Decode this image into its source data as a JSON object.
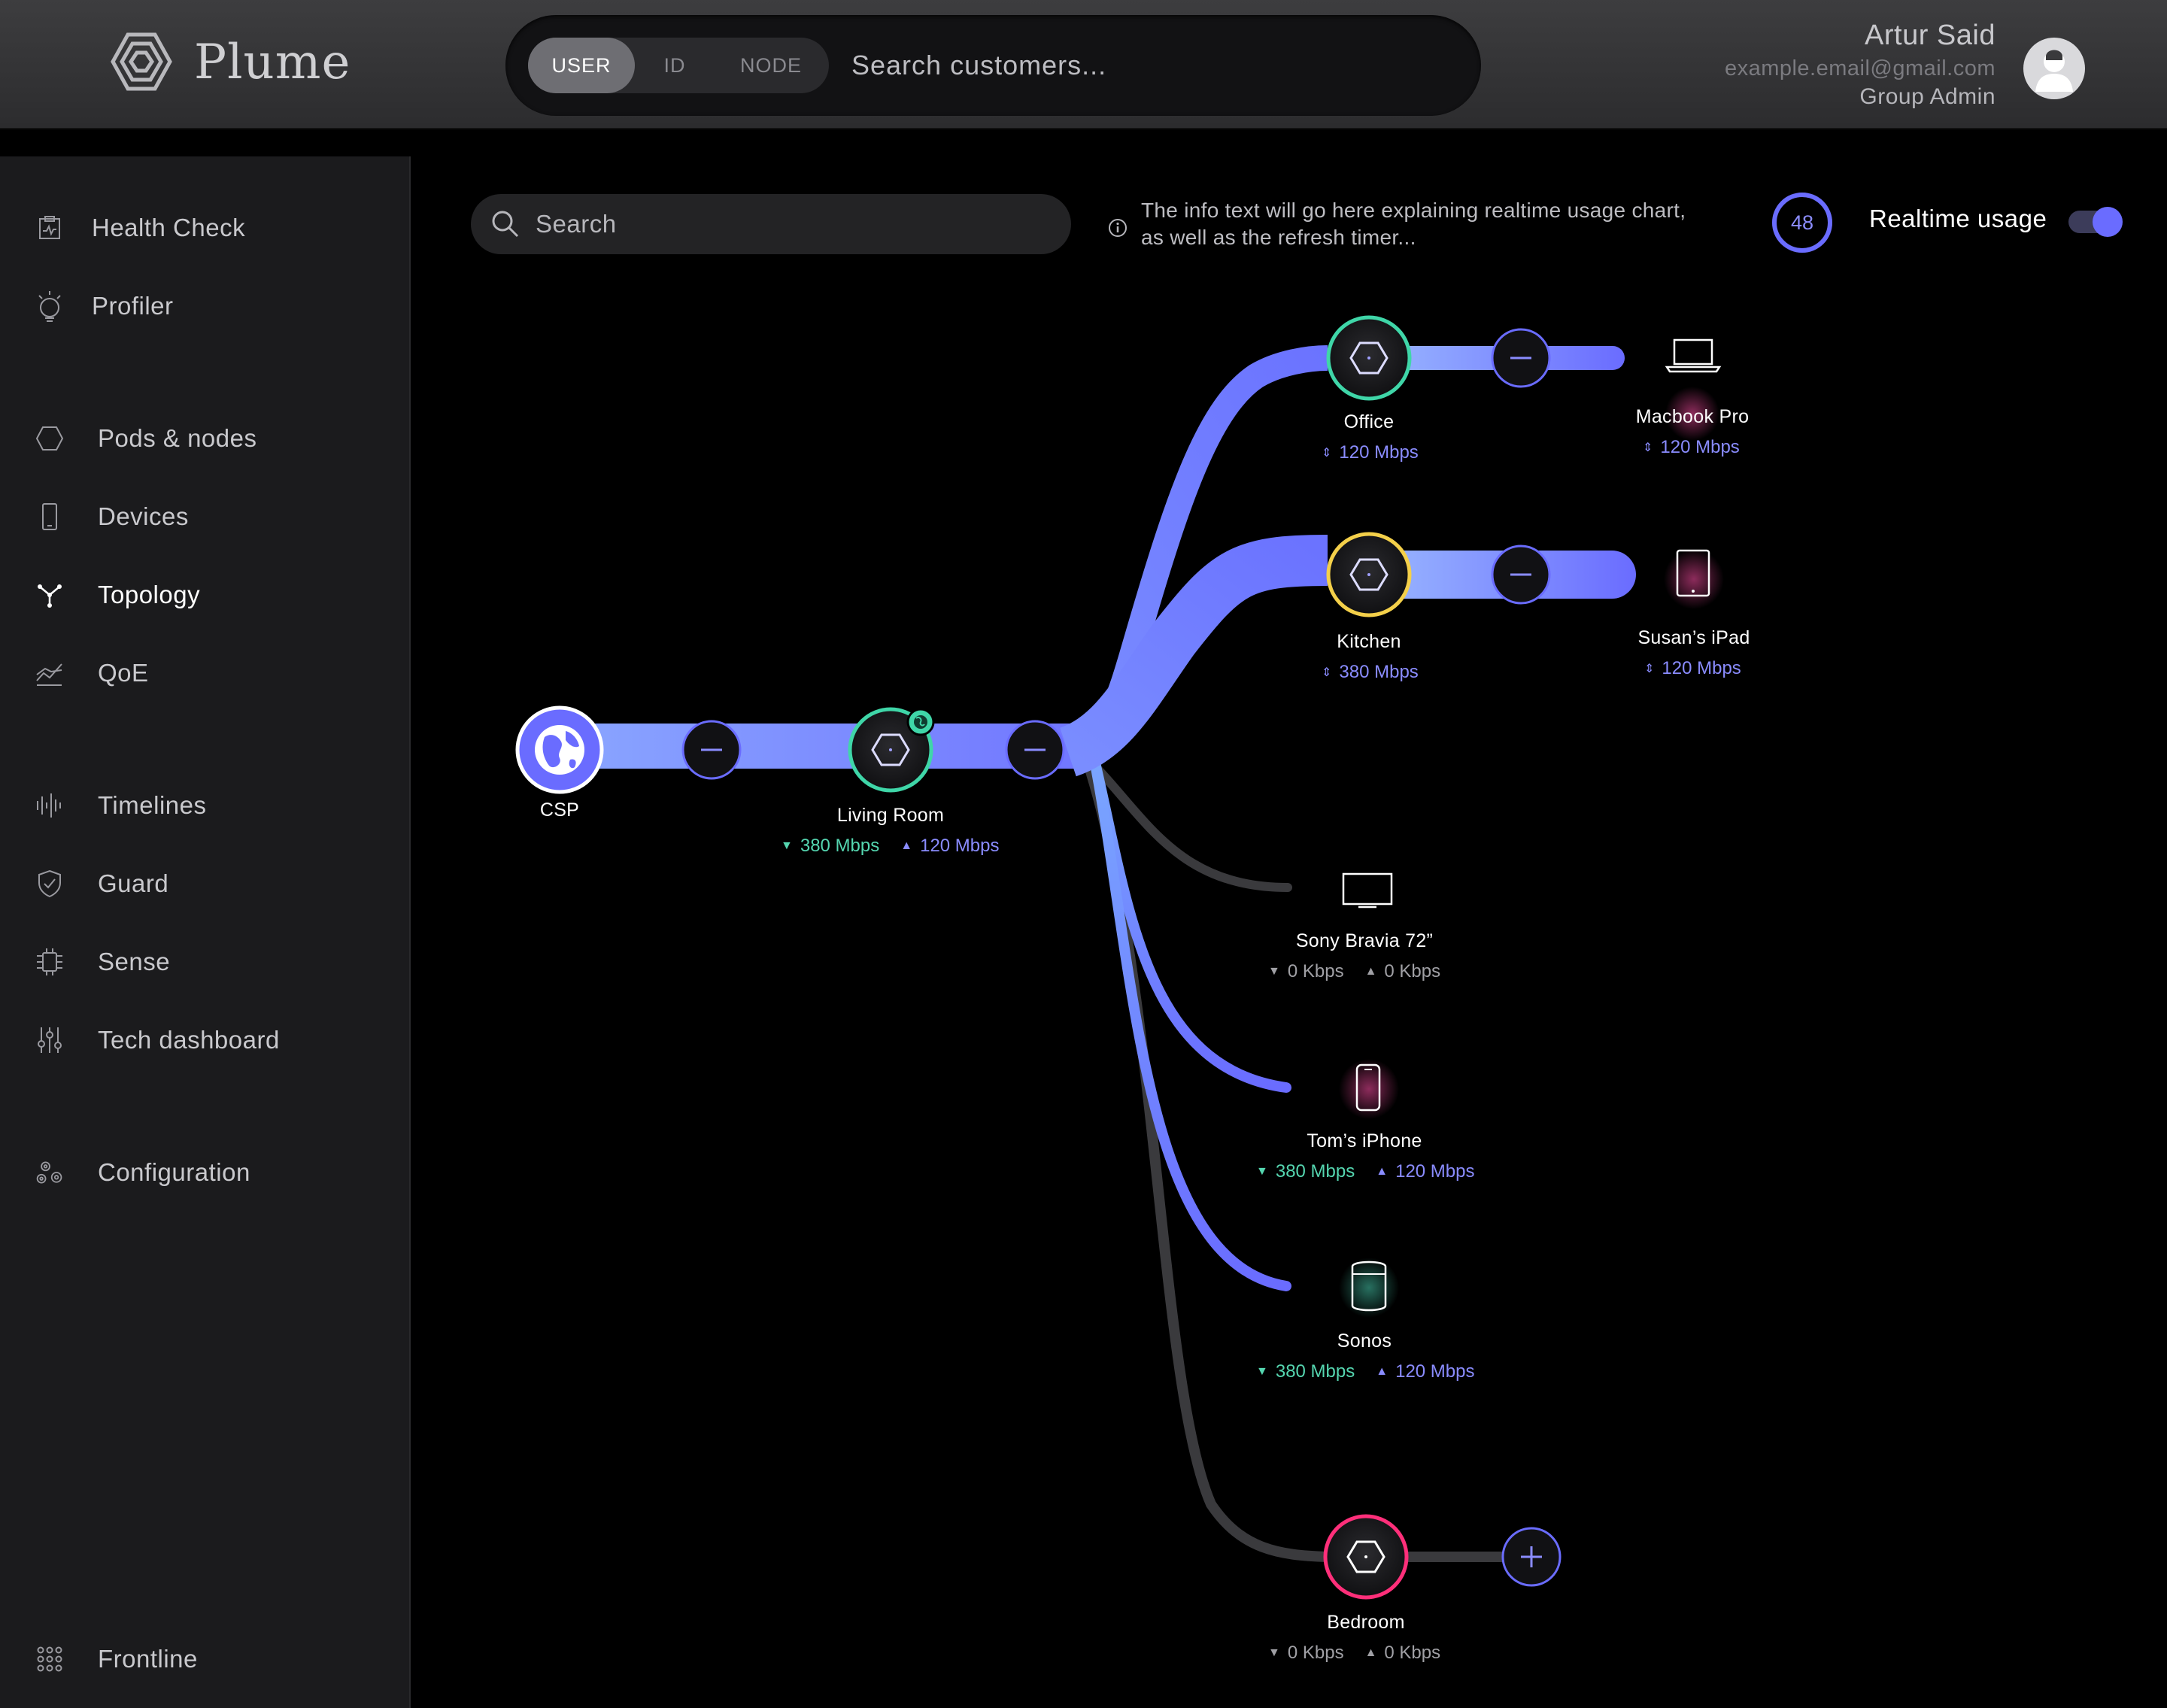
{
  "header": {
    "logo_text": "Plume",
    "search_modes": [
      {
        "label": "USER",
        "active": true
      },
      {
        "label": "ID",
        "active": false
      },
      {
        "label": "NODE",
        "active": false
      }
    ],
    "search_placeholder": "Search customers...",
    "user": {
      "name": "Artur Said",
      "email": "example.email@gmail.com",
      "role": "Group Admin"
    }
  },
  "sidebar": {
    "items": [
      {
        "label": "Health Check",
        "icon": "clipboard-icon",
        "active": false
      },
      {
        "label": "Profiler",
        "icon": "lightbulb-icon",
        "active": false
      },
      {
        "label": "Pods & nodes",
        "icon": "hexagon-icon",
        "active": false
      },
      {
        "label": "Devices",
        "icon": "phone-icon",
        "active": false
      },
      {
        "label": "Topology",
        "icon": "topology-icon",
        "active": true
      },
      {
        "label": "QoE",
        "icon": "trend-chart-icon",
        "active": false
      },
      {
        "label": "Timelines",
        "icon": "waveform-icon",
        "active": false
      },
      {
        "label": "Guard",
        "icon": "shield-icon",
        "active": false
      },
      {
        "label": "Sense",
        "icon": "chip-icon",
        "active": false
      },
      {
        "label": "Tech dashboard",
        "icon": "sliders-icon",
        "active": false
      },
      {
        "label": "Configuration",
        "icon": "gears-icon",
        "active": false
      },
      {
        "label": "Frontline",
        "icon": "grid-dots-icon",
        "active": false
      }
    ]
  },
  "toolbar": {
    "search_placeholder": "Search",
    "info_text": "The info text will go here explaining realtime usage chart, as well as the refresh timer...",
    "timer_value": "48",
    "realtime_label": "Realtime usage",
    "realtime_on": true
  },
  "topology": {
    "colors": {
      "link_active": "#7a7cff",
      "link_idle": "#3a3a3d",
      "ring_green": "#3fd6a8",
      "ring_yellow": "#f4d04a",
      "ring_pink": "#ff2f7a",
      "accent": "#6a6cff"
    },
    "csp": {
      "label": "CSP",
      "icon": "globe-icon"
    },
    "living_room": {
      "label": "Living Room",
      "down": "380 Mbps",
      "up": "120 Mbps",
      "icon": "pod-icon",
      "badge": "globe-icon"
    },
    "office": {
      "label": "Office",
      "rate": "120 Mbps",
      "icon": "pod-icon"
    },
    "kitchen": {
      "label": "Kitchen",
      "rate": "380 Mbps",
      "icon": "pod-icon"
    },
    "bedroom": {
      "label": "Bedroom",
      "down": "0 Kbps",
      "up": "0 Kbps",
      "icon": "pod-icon"
    },
    "macbook": {
      "label": "Macbook Pro",
      "rate": "120 Mbps",
      "icon": "laptop-icon"
    },
    "ipad": {
      "label": "Susan’s iPad",
      "rate": "120 Mbps",
      "icon": "tablet-icon"
    },
    "sony": {
      "label": "Sony Bravia 72”",
      "down": "0 Kbps",
      "up": "0 Kbps",
      "icon": "tv-icon"
    },
    "iphone": {
      "label": "Tom’s iPhone",
      "down": "380 Mbps",
      "up": "120 Mbps",
      "icon": "phone-icon"
    },
    "sonos": {
      "label": "Sonos",
      "down": "380 Mbps",
      "up": "120 Mbps",
      "icon": "speaker-icon"
    }
  }
}
